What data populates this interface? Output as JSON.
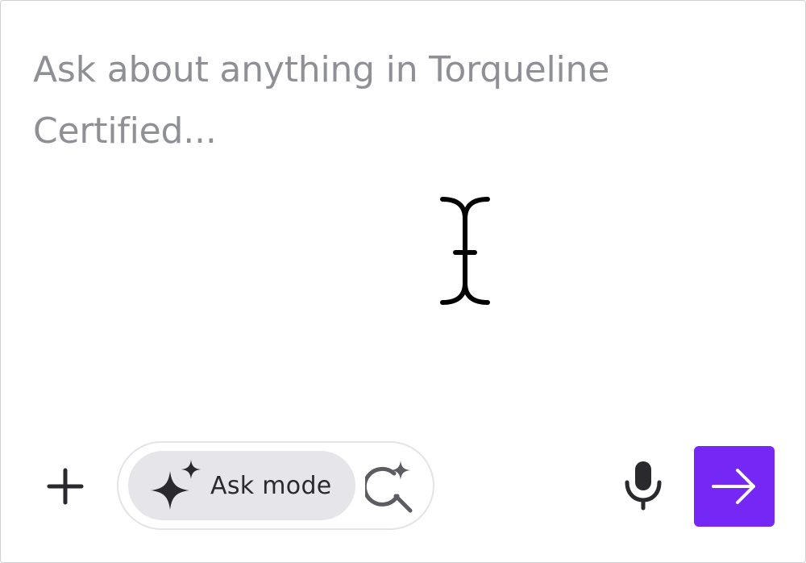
{
  "composer": {
    "placeholder": "Ask about anything in Torqueline Certified..."
  },
  "toolbar": {
    "add_icon": "plus-icon",
    "mode": {
      "label": "Ask mode",
      "icon": "sparkle-icon",
      "selected": true
    },
    "search_mode_icon": "sparkle-search-icon",
    "mic_icon": "microphone-icon",
    "send_icon": "arrow-right-icon"
  },
  "colors": {
    "send_button": "#7427f5",
    "placeholder_text": "#8f8f96",
    "mode_pill_bg": "#e6e6ea",
    "icon_dark": "#2a2a2e"
  }
}
